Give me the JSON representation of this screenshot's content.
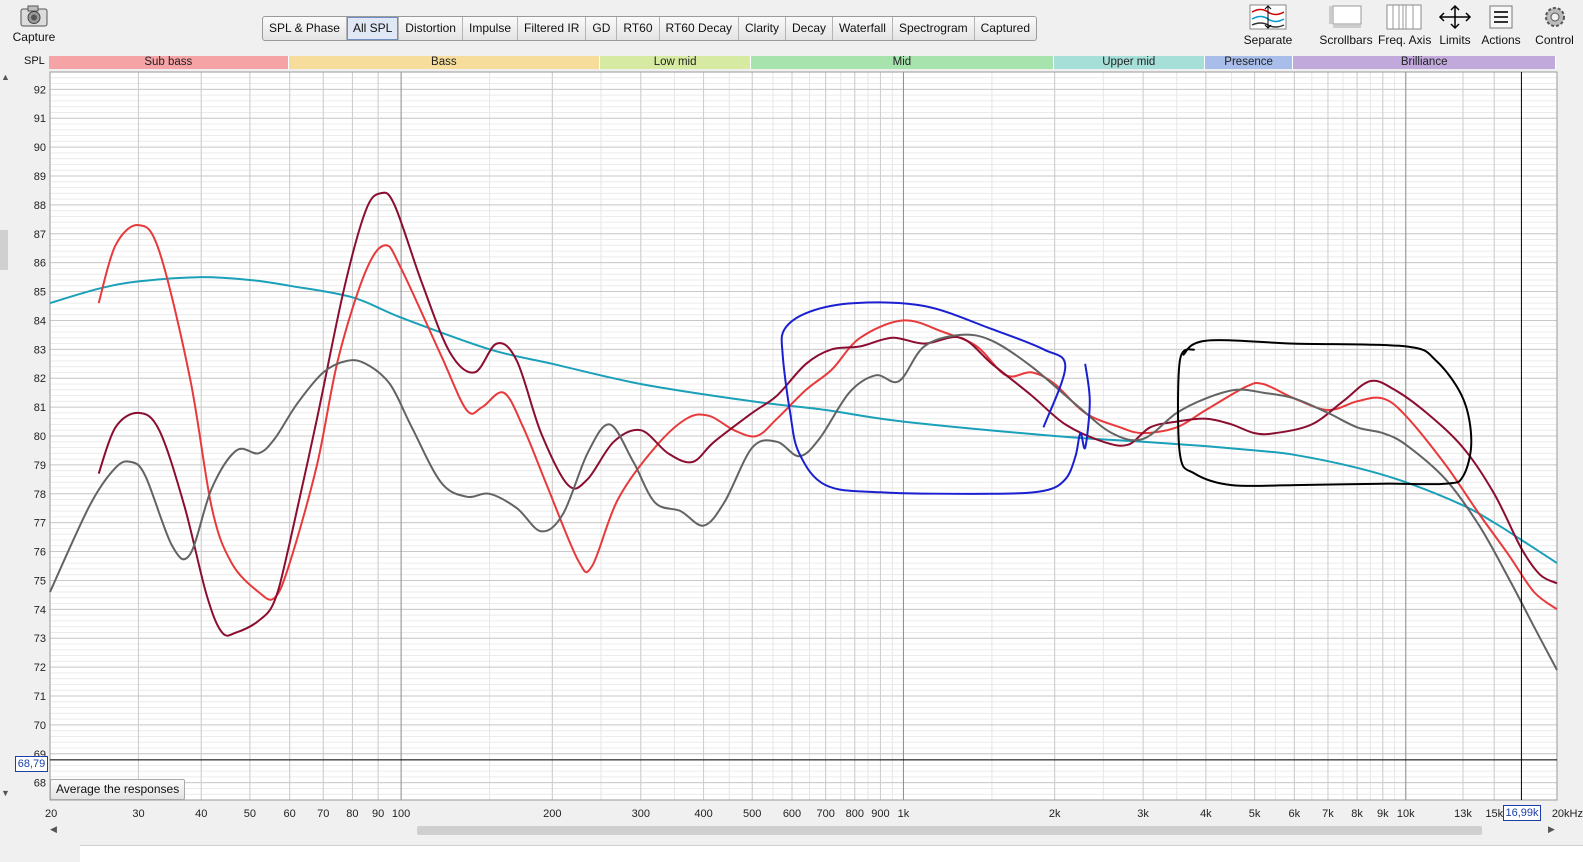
{
  "toolbar": {
    "capture_label": "Capture",
    "tabs": [
      "SPL & Phase",
      "All SPL",
      "Distortion",
      "Impulse",
      "Filtered IR",
      "GD",
      "RT60",
      "RT60 Decay",
      "Clarity",
      "Decay",
      "Waterfall",
      "Spectrogram",
      "Captured"
    ],
    "active_tab": "All SPL",
    "tools": [
      "Separate",
      "Scrollbars",
      "Freq. Axis",
      "Limits",
      "Actions",
      "Control"
    ]
  },
  "bands": [
    {
      "label": "Sub bass",
      "color": "#f6a3a5"
    },
    {
      "label": "Bass",
      "color": "#f6dd9c"
    },
    {
      "label": "Low mid",
      "color": "#d6eba1"
    },
    {
      "label": "Mid",
      "color": "#a6e3ad"
    },
    {
      "label": "Upper mid",
      "color": "#a5dfd8"
    },
    {
      "label": "Presence",
      "color": "#a8bde9"
    },
    {
      "label": "Brilliance",
      "color": "#c1a9dc"
    }
  ],
  "y_unit": "SPL",
  "average_button": "Average the responses",
  "cursor": {
    "y_readout": "68,79",
    "x_readout": "16,99k"
  },
  "chart_data": {
    "type": "line",
    "x_scale": "log",
    "xlim": [
      20,
      20000
    ],
    "ylim": [
      67.4,
      92.6
    ],
    "yticks": [
      68,
      69,
      70,
      71,
      72,
      73,
      74,
      75,
      76,
      77,
      78,
      79,
      80,
      81,
      82,
      83,
      84,
      85,
      86,
      87,
      88,
      89,
      90,
      91,
      92
    ],
    "xticks": [
      {
        "v": 20,
        "l": "20"
      },
      {
        "v": 30,
        "l": "30"
      },
      {
        "v": 40,
        "l": "40"
      },
      {
        "v": 50,
        "l": "50"
      },
      {
        "v": 60,
        "l": "60"
      },
      {
        "v": 70,
        "l": "70"
      },
      {
        "v": 80,
        "l": "80"
      },
      {
        "v": 90,
        "l": "90"
      },
      {
        "v": 100,
        "l": "100"
      },
      {
        "v": 200,
        "l": "200"
      },
      {
        "v": 300,
        "l": "300"
      },
      {
        "v": 400,
        "l": "400"
      },
      {
        "v": 500,
        "l": "500"
      },
      {
        "v": 600,
        "l": "600"
      },
      {
        "v": 700,
        "l": "700"
      },
      {
        "v": 800,
        "l": "800"
      },
      {
        "v": 900,
        "l": "900"
      },
      {
        "v": 1000,
        "l": "1k"
      },
      {
        "v": 2000,
        "l": "2k"
      },
      {
        "v": 3000,
        "l": "3k"
      },
      {
        "v": 4000,
        "l": "4k"
      },
      {
        "v": 5000,
        "l": "5k"
      },
      {
        "v": 6000,
        "l": "6k"
      },
      {
        "v": 7000,
        "l": "7k"
      },
      {
        "v": 8000,
        "l": "8k"
      },
      {
        "v": 9000,
        "l": "9k"
      },
      {
        "v": 10000,
        "l": "10k"
      },
      {
        "v": 13000,
        "l": "13k"
      },
      {
        "v": 15000,
        "l": "15k"
      },
      {
        "v": 20000,
        "l": "20kHz"
      }
    ],
    "band_edges": [
      20,
      60,
      250,
      500,
      2000,
      4000,
      6000,
      20000
    ],
    "cursor_freq": 16990,
    "cursor_spl": 68.79,
    "series": [
      {
        "color": "#1aa0b8",
        "points": [
          [
            20,
            84.6
          ],
          [
            25,
            85.1
          ],
          [
            30,
            85.35
          ],
          [
            40,
            85.5
          ],
          [
            50,
            85.4
          ],
          [
            60,
            85.2
          ],
          [
            80,
            84.8
          ],
          [
            100,
            84.1
          ],
          [
            150,
            83.0
          ],
          [
            200,
            82.5
          ],
          [
            300,
            81.8
          ],
          [
            500,
            81.2
          ],
          [
            700,
            80.9
          ],
          [
            1000,
            80.5
          ],
          [
            2000,
            80.0
          ],
          [
            3000,
            79.8
          ],
          [
            4000,
            79.65
          ],
          [
            5000,
            79.5
          ],
          [
            6000,
            79.35
          ],
          [
            8000,
            78.9
          ],
          [
            10000,
            78.4
          ],
          [
            13000,
            77.6
          ],
          [
            15000,
            77.0
          ],
          [
            17000,
            76.4
          ],
          [
            20000,
            75.6
          ]
        ]
      },
      {
        "color": "#e8393b",
        "points": [
          [
            25,
            84.6
          ],
          [
            27,
            86.6
          ],
          [
            30,
            87.3
          ],
          [
            33,
            86.4
          ],
          [
            38,
            82.0
          ],
          [
            42,
            77.5
          ],
          [
            46,
            75.6
          ],
          [
            52,
            74.6
          ],
          [
            56,
            74.4
          ],
          [
            60,
            75.6
          ],
          [
            68,
            79.0
          ],
          [
            75,
            82.7
          ],
          [
            85,
            85.7
          ],
          [
            93,
            86.6
          ],
          [
            100,
            85.8
          ],
          [
            120,
            82.8
          ],
          [
            135,
            80.9
          ],
          [
            145,
            81.0
          ],
          [
            160,
            81.5
          ],
          [
            175,
            80.3
          ],
          [
            195,
            78.3
          ],
          [
            225,
            75.7
          ],
          [
            240,
            75.5
          ],
          [
            270,
            77.8
          ],
          [
            320,
            79.6
          ],
          [
            370,
            80.6
          ],
          [
            410,
            80.7
          ],
          [
            460,
            80.2
          ],
          [
            510,
            80.0
          ],
          [
            560,
            80.6
          ],
          [
            640,
            81.6
          ],
          [
            720,
            82.3
          ],
          [
            820,
            83.4
          ],
          [
            1000,
            84.0
          ],
          [
            1200,
            83.6
          ],
          [
            1400,
            83.1
          ],
          [
            1600,
            82.1
          ],
          [
            1800,
            82.2
          ],
          [
            2000,
            81.8
          ],
          [
            2300,
            80.8
          ],
          [
            2700,
            80.3
          ],
          [
            3000,
            80.1
          ],
          [
            3500,
            80.3
          ],
          [
            4000,
            80.9
          ],
          [
            4800,
            81.7
          ],
          [
            5200,
            81.8
          ],
          [
            6000,
            81.3
          ],
          [
            7000,
            80.9
          ],
          [
            8000,
            81.2
          ],
          [
            9000,
            81.3
          ],
          [
            10000,
            80.7
          ],
          [
            12000,
            79.0
          ],
          [
            14000,
            77.3
          ],
          [
            16000,
            75.9
          ],
          [
            18000,
            74.6
          ],
          [
            20000,
            74.0
          ]
        ]
      },
      {
        "color": "#8b0d2f",
        "points": [
          [
            25,
            78.7
          ],
          [
            27,
            80.3
          ],
          [
            30,
            80.8
          ],
          [
            33,
            80.2
          ],
          [
            37,
            77.6
          ],
          [
            41,
            74.5
          ],
          [
            44,
            73.2
          ],
          [
            47,
            73.2
          ],
          [
            52,
            73.6
          ],
          [
            56,
            74.3
          ],
          [
            60,
            76.3
          ],
          [
            68,
            80.6
          ],
          [
            77,
            85.1
          ],
          [
            85,
            87.8
          ],
          [
            91,
            88.4
          ],
          [
            97,
            88.0
          ],
          [
            110,
            85.3
          ],
          [
            125,
            82.9
          ],
          [
            140,
            82.2
          ],
          [
            155,
            83.2
          ],
          [
            170,
            82.6
          ],
          [
            190,
            80.1
          ],
          [
            215,
            78.3
          ],
          [
            235,
            78.5
          ],
          [
            265,
            79.8
          ],
          [
            300,
            80.2
          ],
          [
            340,
            79.4
          ],
          [
            380,
            79.1
          ],
          [
            420,
            79.8
          ],
          [
            500,
            80.8
          ],
          [
            560,
            81.4
          ],
          [
            640,
            82.5
          ],
          [
            720,
            83.0
          ],
          [
            820,
            83.1
          ],
          [
            950,
            83.4
          ],
          [
            1100,
            83.2
          ],
          [
            1300,
            83.4
          ],
          [
            1500,
            82.5
          ],
          [
            1800,
            81.4
          ],
          [
            2100,
            80.4
          ],
          [
            2500,
            79.8
          ],
          [
            2800,
            79.7
          ],
          [
            3100,
            80.3
          ],
          [
            3500,
            80.5
          ],
          [
            4000,
            80.6
          ],
          [
            4500,
            80.4
          ],
          [
            5000,
            80.1
          ],
          [
            5500,
            80.1
          ],
          [
            6500,
            80.4
          ],
          [
            7500,
            81.2
          ],
          [
            8500,
            81.9
          ],
          [
            9500,
            81.6
          ],
          [
            11000,
            80.8
          ],
          [
            13000,
            79.6
          ],
          [
            15000,
            78.0
          ],
          [
            17000,
            76.1
          ],
          [
            18500,
            75.2
          ],
          [
            20000,
            74.9
          ]
        ]
      },
      {
        "color": "#636363",
        "points": [
          [
            20,
            74.6
          ],
          [
            24,
            77.6
          ],
          [
            27,
            78.9
          ],
          [
            29,
            79.1
          ],
          [
            31,
            78.6
          ],
          [
            35,
            76.2
          ],
          [
            38,
            75.9
          ],
          [
            42,
            78.2
          ],
          [
            47,
            79.5
          ],
          [
            52,
            79.4
          ],
          [
            56,
            79.9
          ],
          [
            62,
            81.1
          ],
          [
            70,
            82.2
          ],
          [
            78,
            82.6
          ],
          [
            85,
            82.5
          ],
          [
            95,
            81.8
          ],
          [
            105,
            80.3
          ],
          [
            120,
            78.4
          ],
          [
            135,
            77.9
          ],
          [
            150,
            78.0
          ],
          [
            170,
            77.5
          ],
          [
            190,
            76.7
          ],
          [
            210,
            77.3
          ],
          [
            235,
            79.4
          ],
          [
            260,
            80.4
          ],
          [
            290,
            79.1
          ],
          [
            320,
            77.7
          ],
          [
            360,
            77.4
          ],
          [
            400,
            76.9
          ],
          [
            440,
            77.7
          ],
          [
            500,
            79.6
          ],
          [
            560,
            79.8
          ],
          [
            620,
            79.3
          ],
          [
            680,
            79.9
          ],
          [
            780,
            81.5
          ],
          [
            880,
            82.1
          ],
          [
            980,
            81.9
          ],
          [
            1100,
            83.1
          ],
          [
            1300,
            83.5
          ],
          [
            1500,
            83.3
          ],
          [
            1800,
            82.4
          ],
          [
            2200,
            81.1
          ],
          [
            2600,
            80.1
          ],
          [
            3000,
            79.9
          ],
          [
            3500,
            80.8
          ],
          [
            4000,
            81.3
          ],
          [
            4600,
            81.6
          ],
          [
            5200,
            81.5
          ],
          [
            6000,
            81.3
          ],
          [
            7000,
            80.8
          ],
          [
            8000,
            80.3
          ],
          [
            9000,
            80.1
          ],
          [
            10000,
            79.7
          ],
          [
            12000,
            78.5
          ],
          [
            14000,
            76.9
          ],
          [
            16000,
            75.1
          ],
          [
            18000,
            73.4
          ],
          [
            20000,
            71.9
          ]
        ]
      }
    ],
    "annotations": [
      {
        "color": "#1a1fd0",
        "points": [
          [
            1900,
            80.3
          ],
          [
            2100,
            82.4
          ],
          [
            1900,
            83.0
          ],
          [
            1500,
            83.7
          ],
          [
            1100,
            84.5
          ],
          [
            800,
            84.6
          ],
          [
            650,
            84.3
          ],
          [
            580,
            83.7
          ],
          [
            575,
            82.8
          ],
          [
            595,
            80.8
          ],
          [
            620,
            79.4
          ],
          [
            700,
            78.3
          ],
          [
            900,
            78.05
          ],
          [
            1500,
            78.0
          ],
          [
            1900,
            78.1
          ],
          [
            2100,
            78.5
          ],
          [
            2200,
            79.3
          ],
          [
            2250,
            80.1
          ],
          [
            2300,
            79.6
          ],
          [
            2350,
            81.2
          ],
          [
            2300,
            82.5
          ]
        ]
      },
      {
        "color": "#000000",
        "points": [
          [
            3600,
            82.8
          ],
          [
            4000,
            83.3
          ],
          [
            6000,
            83.2
          ],
          [
            10000,
            83.1
          ],
          [
            11500,
            82.6
          ],
          [
            13000,
            81.3
          ],
          [
            13500,
            79.8
          ],
          [
            13000,
            78.6
          ],
          [
            12000,
            78.35
          ],
          [
            9000,
            78.35
          ],
          [
            6000,
            78.3
          ],
          [
            4500,
            78.3
          ],
          [
            3800,
            78.7
          ],
          [
            3550,
            79.4
          ],
          [
            3550,
            82.6
          ],
          [
            3800,
            83.0
          ]
        ]
      }
    ]
  }
}
